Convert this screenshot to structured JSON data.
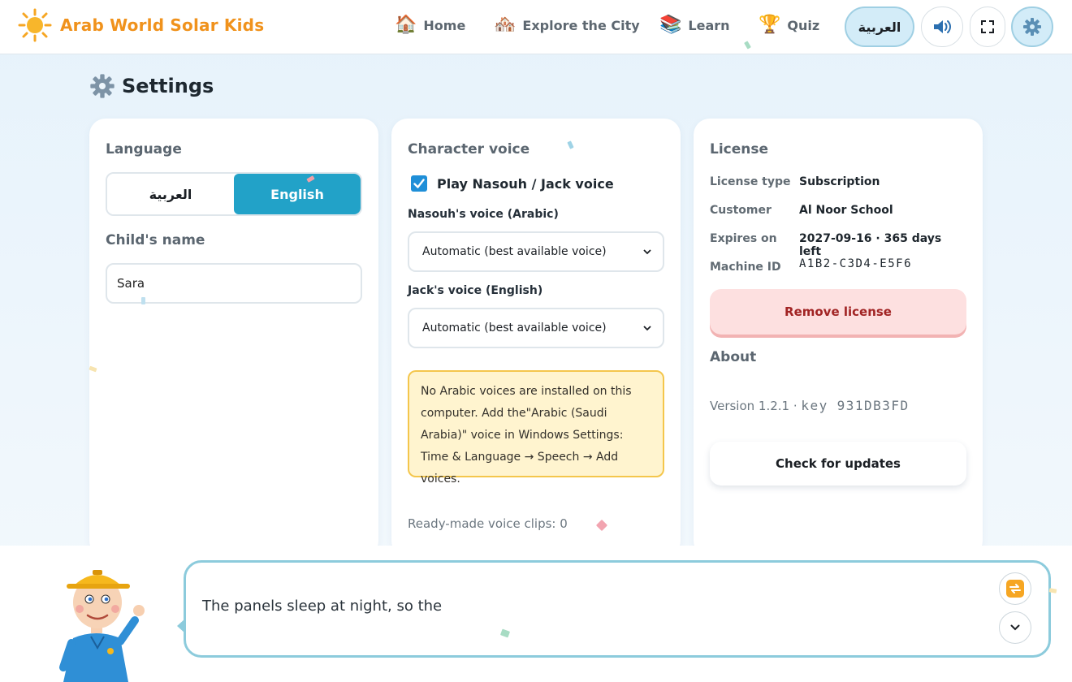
{
  "app": {
    "name": "Arab World Solar Kids",
    "logo_icon": "sun-icon",
    "accent": "#f0921c"
  },
  "nav": [
    {
      "label": "Home",
      "icon": "house-icon"
    },
    {
      "label": "Explore the City",
      "icon": "city-icon"
    },
    {
      "label": "Learn",
      "icon": "books-icon"
    },
    {
      "label": "Quiz",
      "icon": "trophy-icon"
    }
  ],
  "header_controls": {
    "language_toggle": "العربية",
    "sound_icon": "speaker-icon",
    "fullscreen_icon": "fullscreen-icon",
    "settings_icon": "gear-icon"
  },
  "page": {
    "title": "Settings",
    "icon": "gear-icon"
  },
  "language_card": {
    "title": "Language",
    "options": [
      "العربية",
      "English"
    ],
    "selected": "English",
    "child_name_label": "Child's name",
    "child_name_value": "Sara"
  },
  "voice_card": {
    "title": "Character voice",
    "play_voice_label": "Play Nasouh / Jack voice",
    "play_voice_checked": true,
    "arabic_voice_label": "Nasouh's voice (Arabic)",
    "arabic_voice_value": "Automatic (best available voice)",
    "english_voice_label": "Jack's voice (English)",
    "english_voice_value": "Automatic (best available voice)",
    "notice": "No Arabic voices are installed on this computer. Add the\"Arabic (Saudi Arabia)\" voice in Windows Settings: Time & Language → Speech → Add voices.",
    "clips": "Ready-made voice clips: 0"
  },
  "license_card": {
    "title": "License",
    "rows": [
      {
        "key": "License type",
        "value": "Subscription"
      },
      {
        "key": "Customer",
        "value": "Al Noor School"
      },
      {
        "key": "Expires on",
        "value": "2027-09-16 · 365 days left"
      },
      {
        "key": "Machine ID",
        "value": "A1B2-C3D4-E5F6"
      }
    ],
    "remove_button": "Remove license",
    "about_title": "About",
    "version_text": "Version 1.2.1 · ",
    "key_label": "key",
    "key_value": "931DB3FD",
    "update_button": "Check for updates"
  },
  "speech": {
    "text": "The panels sleep at night, so the",
    "replay_icon": "replay-icon",
    "collapse_icon": "chevron-down-icon"
  }
}
